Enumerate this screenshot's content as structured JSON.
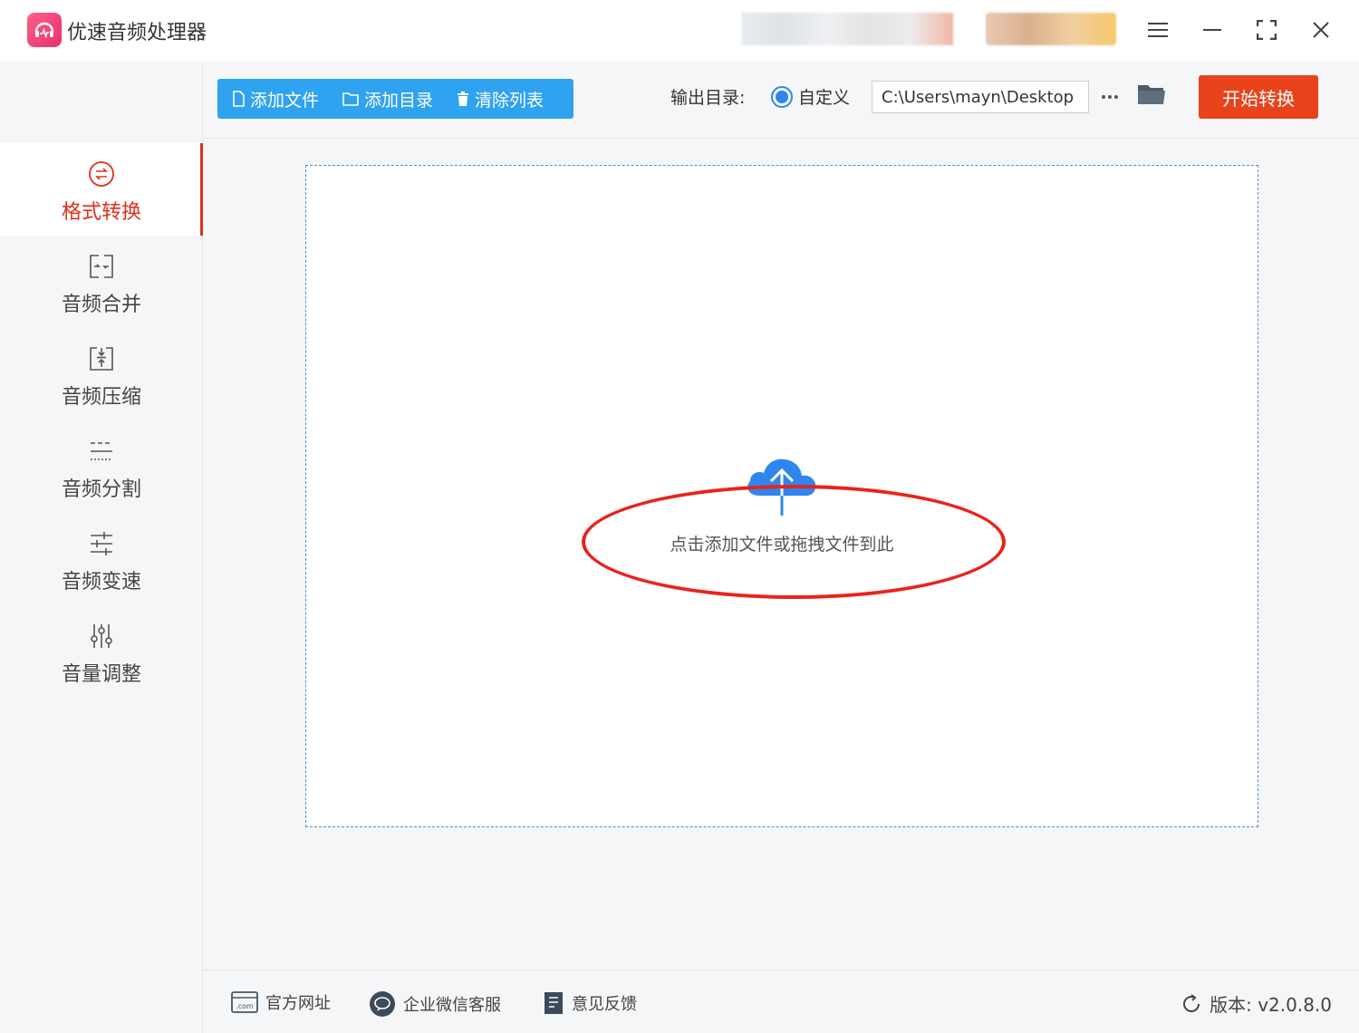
{
  "app": {
    "title": "优速音频处理器",
    "accent_color": "#e8431c",
    "primary_color": "#2fa3f0"
  },
  "window_controls": {
    "menu_icon": "menu-icon",
    "minimize_icon": "minimize-icon",
    "maximize_icon": "fullscreen-icon",
    "close_icon": "close-icon"
  },
  "sidebar": {
    "items": [
      {
        "label": "格式转换",
        "icon": "convert-icon",
        "active": true
      },
      {
        "label": "音频合并",
        "icon": "merge-icon",
        "active": false
      },
      {
        "label": "音频压缩",
        "icon": "compress-icon",
        "active": false
      },
      {
        "label": "音频分割",
        "icon": "split-icon",
        "active": false
      },
      {
        "label": "音频变速",
        "icon": "speed-icon",
        "active": false
      },
      {
        "label": "音量调整",
        "icon": "volume-icon",
        "active": false
      }
    ]
  },
  "toolbar": {
    "add_file": "添加文件",
    "add_folder": "添加目录",
    "clear_list": "清除列表",
    "output_label": "输出目录:",
    "radio_label": "自定义",
    "output_path": "C:\\Users\\mayn\\Desktop",
    "start_label": "开始转换"
  },
  "dropzone": {
    "icon": "cloud-upload-icon",
    "text": "点击添加文件或拖拽文件到此"
  },
  "footer": {
    "website": "官方网址",
    "wechat": "企业微信客服",
    "feedback": "意见反馈",
    "version": "版本: v2.0.8.0"
  }
}
